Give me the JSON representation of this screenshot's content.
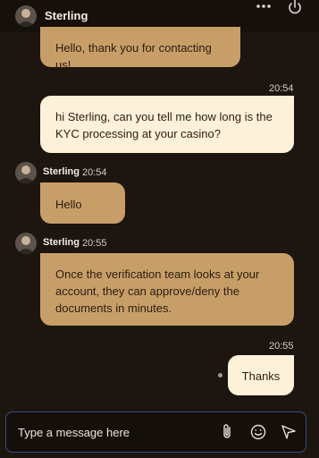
{
  "header": {
    "agent_name": "Sterling",
    "menu_icon": "more-horizontal-icon",
    "power_icon": "power-icon"
  },
  "messages": [
    {
      "from": "agent",
      "text": "Hello, thank you for contacting us!"
    },
    {
      "from": "user",
      "time": "20:54",
      "text": "hi Sterling, can you tell me how long is the KYC processing at your casino?"
    },
    {
      "from": "agent",
      "sender": "Sterling",
      "time": "20:54",
      "text": "Hello"
    },
    {
      "from": "agent",
      "sender": "Sterling",
      "time": "20:55",
      "text": "Once the verification team looks at your account, they can approve/deny the documents in minutes."
    },
    {
      "from": "user",
      "time": "20:55",
      "text": "Thanks"
    }
  ],
  "composer": {
    "placeholder": "Type a message here",
    "value": "",
    "attach_icon": "paperclip-icon",
    "emoji_icon": "smiley-icon",
    "send_icon": "send-icon"
  },
  "colors": {
    "background": "#1d150f",
    "agent_bubble": "#c89e68",
    "user_bubble": "#fdf2d9",
    "input_border": "#3a4a86"
  }
}
